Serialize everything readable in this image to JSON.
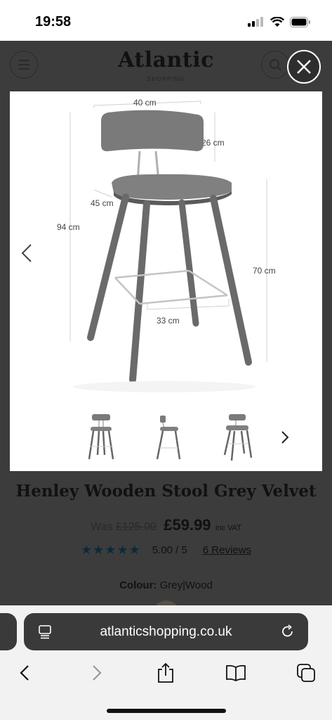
{
  "status_bar": {
    "time": "19:58"
  },
  "site": {
    "logo": "Atlantic",
    "logo_sub": "SHOPPING",
    "gallery": {
      "dimensions": {
        "width": "40 cm",
        "back_height": "26 cm",
        "seat_depth": "45 cm",
        "total_height": "94 cm",
        "seat_height": "70 cm",
        "footrest": "33 cm"
      }
    },
    "product": {
      "title": "Henley Wooden Stool Grey Velvet",
      "was_label": "Was",
      "was_price": "£125.00",
      "price": "£59.99",
      "inc_vat": "inc VAT",
      "stars": "★★★★★",
      "rating": "5.00 / 5",
      "reviews": "6 Reviews",
      "colour_label": "Colour:",
      "colour_value": "Grey|Wood"
    }
  },
  "browser": {
    "url": "atlanticshopping.co.uk"
  },
  "colors": {
    "overlay": "#3c3c3c",
    "star": "#0c2a3a",
    "chrome": "#f2f2f2"
  }
}
